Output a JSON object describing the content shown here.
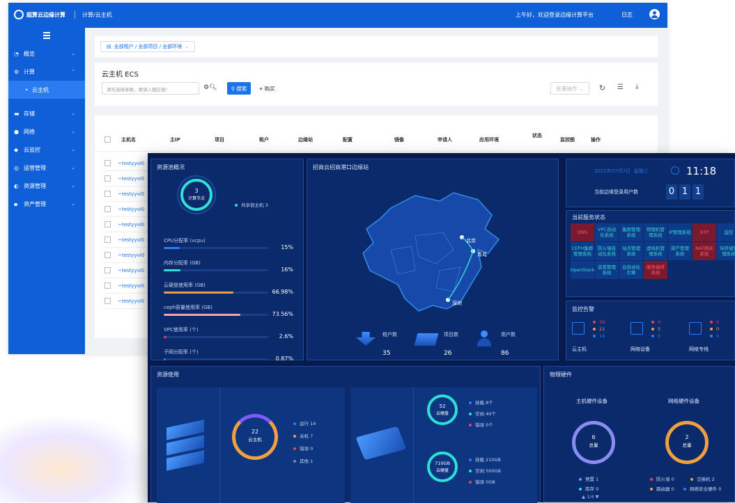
{
  "app": {
    "logo_text": "超算云边缘计算",
    "breadcrumb_top": "计算/云主机",
    "greeting": "上午好，欢迎登录边缘计算平台",
    "log_label": "日志"
  },
  "sidebar": {
    "items": [
      {
        "label": "概览",
        "icon": "overview-icon"
      },
      {
        "label": "计算",
        "icon": "compute-icon"
      },
      {
        "label": "云主机",
        "icon": "dot"
      },
      {
        "label": "存储",
        "icon": "storage-icon"
      },
      {
        "label": "网络",
        "icon": "network-icon"
      },
      {
        "label": "云监控",
        "icon": "monitor-icon"
      },
      {
        "label": "运营管理",
        "icon": "ops-icon"
      },
      {
        "label": "资源管理",
        "icon": "resource-icon"
      },
      {
        "label": "资产管理",
        "icon": "asset-icon"
      }
    ]
  },
  "filter": {
    "scope_text": "全部租户 / 全部项目 / 全部环境"
  },
  "page": {
    "title": "云主机 ECS",
    "search_placeholder": "请先选择参数，再填入相应值！",
    "search_label": "搜索",
    "buy_label": "购买",
    "batch_label": "批量操作"
  },
  "table": {
    "headers": [
      "主机名",
      "主IP",
      "项目",
      "租户",
      "边缘站",
      "配置",
      "镜像",
      "申请人",
      "应用环境",
      "状态",
      "监控图",
      "操作"
    ],
    "rows": [
      "~testyyvi0",
      "~testyyvi0",
      "~testyyvi0",
      "~testyyvi0",
      "~testyyvi0",
      "~testyyvi0",
      "~testyyvi0",
      "~testyyvi0",
      "~testyyvi0",
      "~testyyvi0"
    ]
  },
  "dashboard": {
    "pool": {
      "title": "资源池概况",
      "ring_value": "3",
      "ring_label": "计算节点",
      "legend": "共享宿主机 3",
      "bars": [
        {
          "label": "CPU分配率 (vcpu)",
          "value": "15%",
          "ratio": 0.15,
          "color": "#2f7cf6"
        },
        {
          "label": "内存分配率 (GB)",
          "value": "16%",
          "ratio": 0.16,
          "color": "#2fe0d8"
        },
        {
          "label": "云硬盘使用率 (GB)",
          "value": "66.98%",
          "ratio": 0.6698,
          "color": "#f0a040"
        },
        {
          "label": "ceph容量使用率 (GB)",
          "value": "73.56%",
          "ratio": 0.7356,
          "color": "#f6a5b0"
        },
        {
          "label": "VPC使用率 (个)",
          "value": "2.6%",
          "ratio": 0.026,
          "color": "#e84060"
        },
        {
          "label": "子网分配率 (个)",
          "value": "0.87%",
          "ratio": 0.0087,
          "color": "#2f7cf6"
        }
      ]
    },
    "map": {
      "title": "招商云招商港口边缘站",
      "cities": [
        "北京",
        "青岛",
        "深圳"
      ],
      "stats": [
        {
          "label": "租户数",
          "value": "35"
        },
        {
          "label": "项目数",
          "value": "26"
        },
        {
          "label": "用户数",
          "value": "86"
        }
      ]
    },
    "clock": {
      "date": "2021年07月7日",
      "weekday": "星期三",
      "time": "11:18",
      "users_label": "当前边缘登录用户数",
      "digits": [
        "0",
        "1",
        "1"
      ]
    },
    "services": {
      "title": "当前服务状态",
      "items": [
        {
          "t": "DNS",
          "s": "bad"
        },
        {
          "t": "VPC自动化系统",
          "s": "ok"
        },
        {
          "t": "集群管理系统",
          "s": "ok"
        },
        {
          "t": "物理机管理系统",
          "s": "ok"
        },
        {
          "t": "IP管理系统",
          "s": "ok"
        },
        {
          "t": "NTP",
          "s": "bad"
        },
        {
          "t": "监控",
          "s": "ok"
        },
        {
          "t": "CEPH集群管理系统",
          "s": "ok"
        },
        {
          "t": "防火墙自动化系统",
          "s": "ok"
        },
        {
          "t": "站点管理系统",
          "s": "ok"
        },
        {
          "t": "虚拟机管理系统",
          "s": "ok"
        },
        {
          "t": "资产管理系统",
          "s": "ok"
        },
        {
          "t": "NAT网关系统",
          "s": "bad"
        },
        {
          "t": "块存储管理系统",
          "s": "ok"
        },
        {
          "t": "OpenStack",
          "s": "ok"
        },
        {
          "t": "运营管理系统",
          "s": "ok"
        },
        {
          "t": "云自动化引擎",
          "s": "ok"
        },
        {
          "t": "服务编排系统",
          "s": "bad"
        }
      ]
    },
    "alerts": {
      "title": "监控告警",
      "groups": [
        {
          "label": "云主机",
          "vals": [
            "58",
            "21",
            "14"
          ]
        },
        {
          "label": "网络设备",
          "vals": [
            "0",
            "5",
            "0"
          ]
        },
        {
          "label": "网络专线",
          "vals": [
            "0",
            "0",
            "0"
          ]
        }
      ]
    },
    "usage": {
      "title": "资源使用",
      "vm": {
        "value": "22",
        "label": "云主机",
        "legend": [
          "运行 14",
          "关机 7",
          "错误 0",
          "其他 1"
        ]
      },
      "disk1": {
        "value": "52",
        "label": "云硬盘",
        "legend": [
          "挂载 8个",
          "空闲 40个",
          "错误 0个"
        ]
      },
      "disk2": {
        "value": "710GB",
        "label": "云硬盘",
        "legend": [
          "挂载 210GB",
          "空闲 500GB",
          "错误 0GB"
        ]
      }
    },
    "hardware": {
      "title": "物理硬件",
      "host_title": "主机硬件设备",
      "net_title": "网络硬件设备",
      "host_value": "6",
      "host_label": "总量",
      "net_value": "2",
      "net_label": "总量",
      "host_legend": [
        "预置 1",
        "库存 0"
      ],
      "net_legend": [
        "防火墙 0",
        "交换机 2",
        "路由器 0",
        "网络安全硬件 0"
      ],
      "pager": "1/4"
    }
  },
  "colors": {
    "brand": "#0e5fd8",
    "dash_bg": "#071a4d",
    "panel": "#0a2a6b",
    "cyan": "#2fe0d8",
    "orange": "#f0a040",
    "red": "#e84060"
  }
}
